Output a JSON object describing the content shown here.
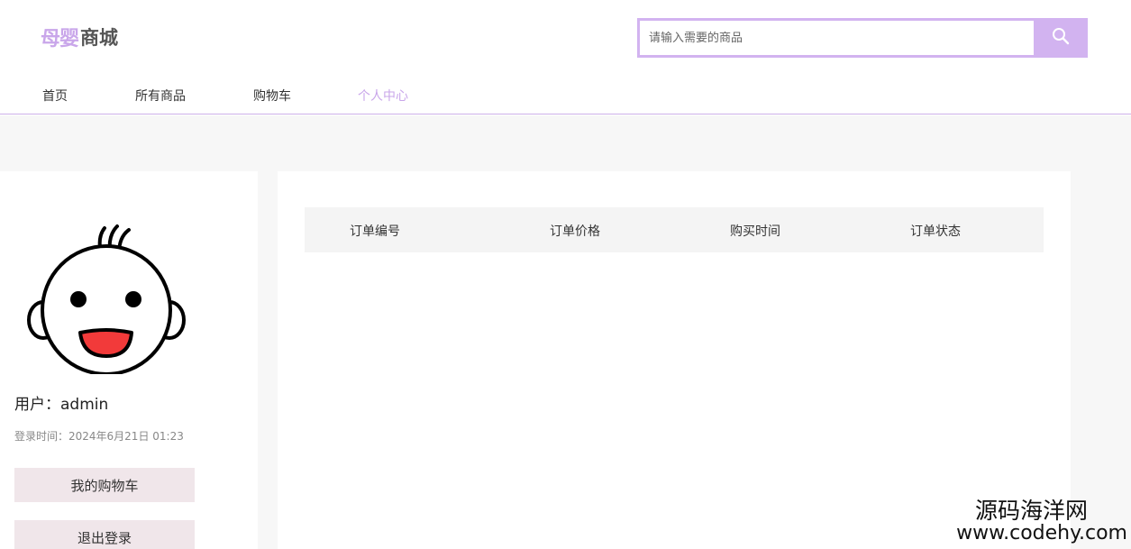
{
  "header": {
    "logo_mark": "母婴",
    "logo_text": "商城",
    "search": {
      "placeholder": "请输入需要的商品",
      "icon": "search-icon"
    }
  },
  "nav": {
    "items": [
      {
        "label": "首页",
        "active": false
      },
      {
        "label": "所有商品",
        "active": false
      },
      {
        "label": "购物车",
        "active": false
      },
      {
        "label": "个人中心",
        "active": true
      }
    ]
  },
  "sidebar": {
    "avatar": "baby-face-avatar",
    "user_name": "用户：admin",
    "login_time": "登录时间：2024年6月21日 01:23",
    "cart_button": "我的购物车",
    "logout_button": "退出登录"
  },
  "orders": {
    "columns": [
      "订单编号",
      "订单价格",
      "购买时间",
      "订单状态"
    ],
    "rows": []
  },
  "watermark": {
    "title": "源码海洋网",
    "url": "www.codehy.com"
  },
  "colors": {
    "accent": "#c9a6ea",
    "search_border": "#d2b3f0",
    "button_bg": "#f0e6ea",
    "page_bg": "#f7f7f7"
  }
}
